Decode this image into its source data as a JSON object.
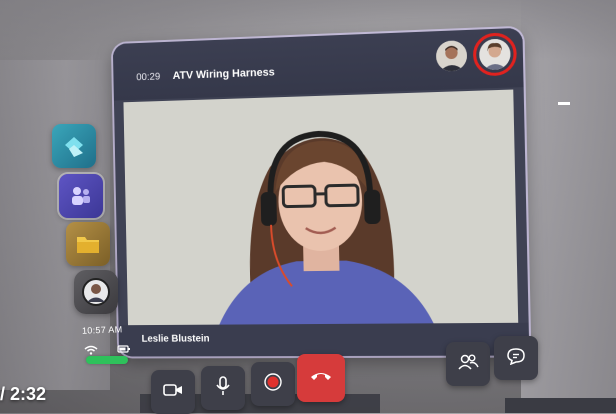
{
  "call": {
    "timer": "00:29",
    "title": "ATV Wiring Harness",
    "speaker_name": "Leslie Blustein"
  },
  "status": {
    "clock": "10:57 AM"
  },
  "overlay": {
    "video_time": "/ 2:32"
  },
  "icons": {
    "dock": [
      "dynamics-guides-icon",
      "teams-icon",
      "folder-icon",
      "profile-icon"
    ],
    "controls": [
      "camera-icon",
      "microphone-icon",
      "record-icon",
      "hang-up-icon",
      "participants-icon",
      "chat-icon"
    ],
    "status": [
      "wifi-icon",
      "battery-icon"
    ]
  },
  "colors": {
    "hangup": "#d63b3b",
    "selected_outline": "#e0221f",
    "status_bar": "#2ec15b",
    "window": "#3f4254"
  }
}
